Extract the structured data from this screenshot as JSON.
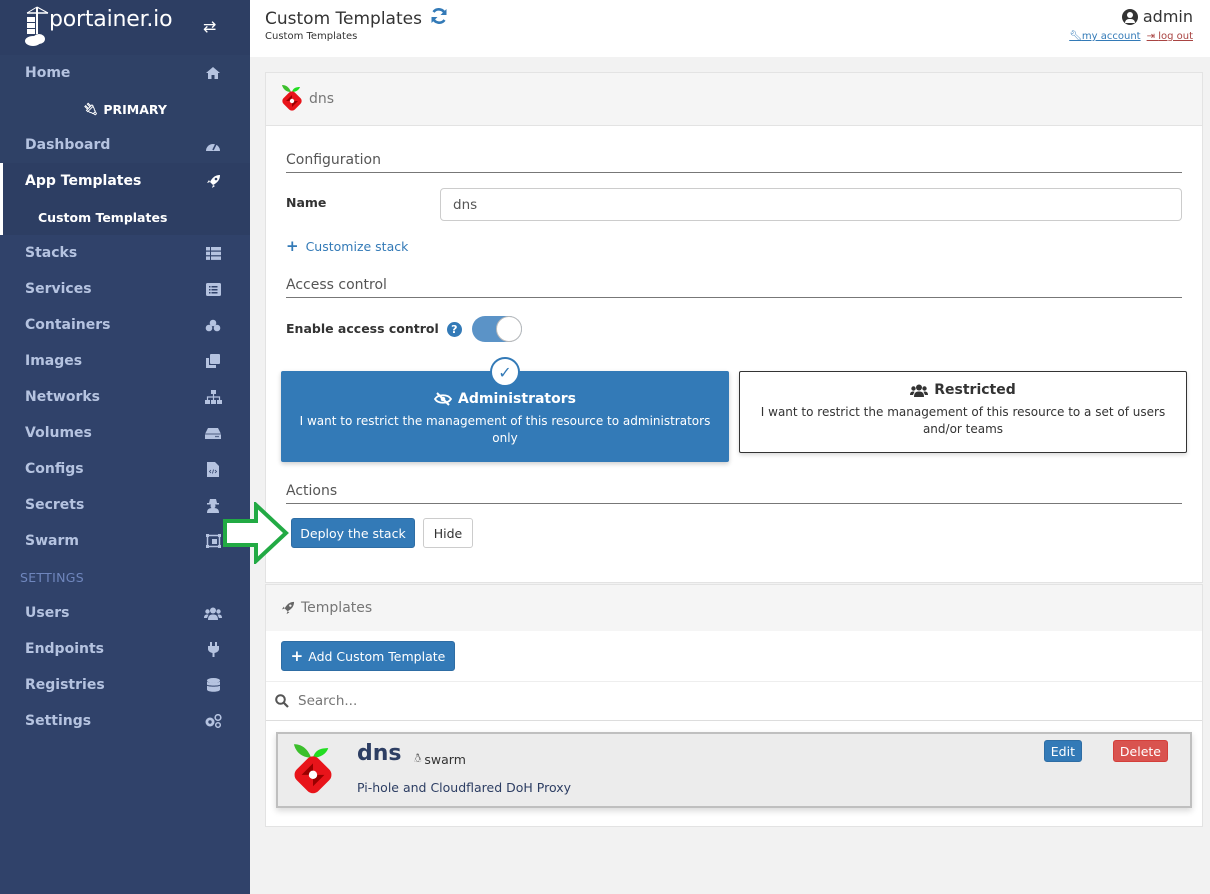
{
  "brand": {
    "logo_text": "portainer.io"
  },
  "sidebar": {
    "home": "Home",
    "endpoint": "PRIMARY",
    "items": [
      {
        "label": "Dashboard",
        "icon": "tachometer-icon"
      },
      {
        "label": "App Templates",
        "icon": "rocket-icon",
        "active": true
      },
      {
        "label": "Custom Templates",
        "sub": true,
        "active": true
      },
      {
        "label": "Stacks",
        "icon": "th-list-icon"
      },
      {
        "label": "Services",
        "icon": "list-alt-icon"
      },
      {
        "label": "Containers",
        "icon": "cubes-icon"
      },
      {
        "label": "Images",
        "icon": "clone-icon"
      },
      {
        "label": "Networks",
        "icon": "sitemap-icon"
      },
      {
        "label": "Volumes",
        "icon": "hdd-icon"
      },
      {
        "label": "Configs",
        "icon": "file-code-icon"
      },
      {
        "label": "Secrets",
        "icon": "user-secret-icon"
      },
      {
        "label": "Swarm",
        "icon": "object-group-icon"
      }
    ],
    "settings_heading": "SETTINGS",
    "settings_items": [
      {
        "label": "Users",
        "icon": "users-icon"
      },
      {
        "label": "Endpoints",
        "icon": "plug-icon"
      },
      {
        "label": "Registries",
        "icon": "database-icon"
      },
      {
        "label": "Settings",
        "icon": "cogs-icon"
      }
    ]
  },
  "header": {
    "title": "Custom Templates",
    "breadcrumb": "Custom Templates",
    "username": "admin",
    "my_account": "my account",
    "log_out": "log out"
  },
  "template_form": {
    "template_name": "dns",
    "configuration_title": "Configuration",
    "name_label": "Name",
    "name_value": "dns",
    "customize_stack": "Customize stack",
    "access_control_title": "Access control",
    "enable_access_control_label": "Enable access control",
    "access_control_enabled": true,
    "options": {
      "admin": {
        "title": "Administrators",
        "description": "I want to restrict the management of this resource to administrators only",
        "selected": true
      },
      "restricted": {
        "title": "Restricted",
        "description": "I want to restrict the management of this resource to a set of users and/or teams",
        "selected": false
      }
    },
    "actions_title": "Actions",
    "deploy_button": "Deploy the stack",
    "hide_button": "Hide"
  },
  "templates_panel": {
    "title": "Templates",
    "add_button": "Add Custom Template",
    "search_placeholder": "Search...",
    "items": [
      {
        "title": "dns",
        "platform": "swarm",
        "description": "Pi-hole and Cloudflared DoH Proxy",
        "edit_label": "Edit",
        "delete_label": "Delete"
      }
    ]
  },
  "colors": {
    "sidebar_bg": "#30426a",
    "primary": "#337ab7",
    "danger": "#d9534f",
    "annotation_arrow": "#22aa44"
  }
}
